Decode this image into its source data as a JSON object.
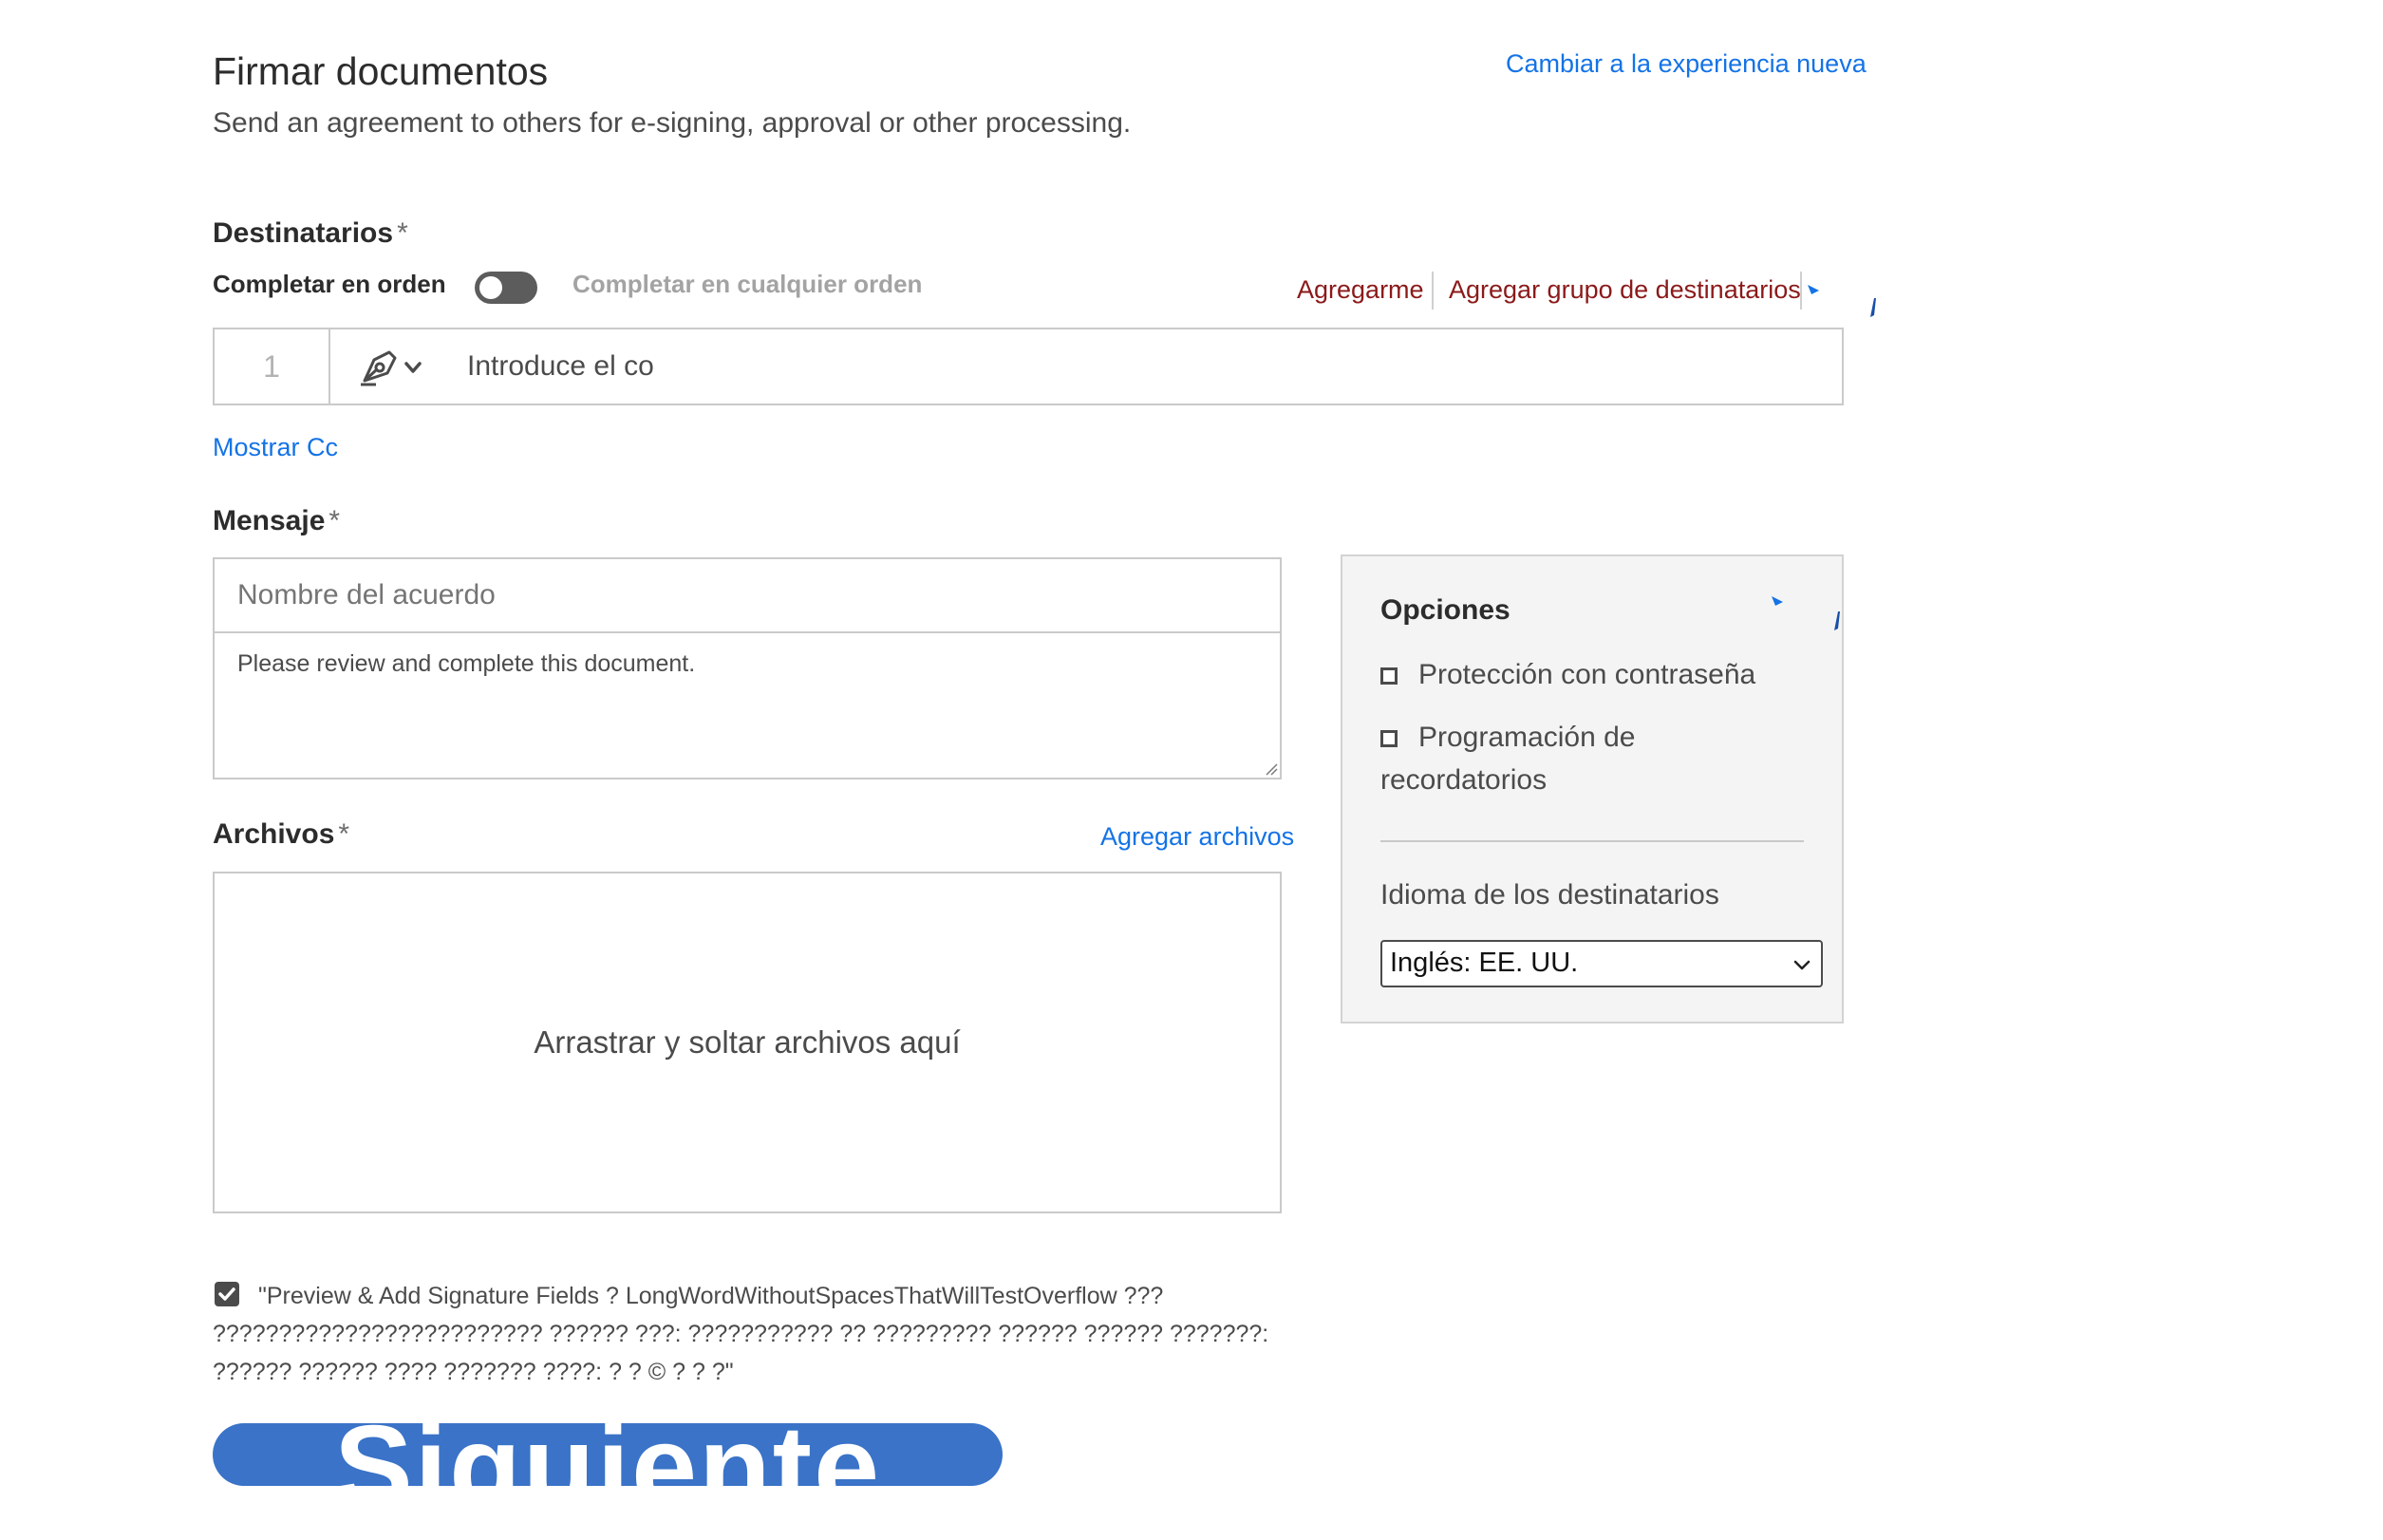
{
  "header": {
    "title": "Firmar documentos",
    "subtitle": "Send an agreement to others for e-signing, approval or other processing.",
    "switch_experience_link": "Cambiar a la experiencia nueva"
  },
  "recipients": {
    "label": "Destinatarios",
    "required_mark": "*",
    "complete_in_order_label": "Completar en orden",
    "complete_in_order_toggle": false,
    "complete_any_order_label": "Completar en cualquier orden",
    "add_me_link": "Agregarme",
    "add_group_link": "Agregar grupo de destinatarios",
    "rows": [
      {
        "number": "1",
        "role_icon": "pen-nib-icon",
        "input_value": "Introduce el co"
      }
    ],
    "show_cc_link": "Mostrar Cc"
  },
  "message": {
    "label": "Mensaje",
    "required_mark": "*",
    "agreement_name_placeholder": "Nombre del acuerdo",
    "body_value": "Please review and complete this document."
  },
  "files": {
    "label": "Archivos",
    "required_mark": "*",
    "add_files_link": "Agregar archivos",
    "drop_zone_text": "Arrastrar y soltar archivos aquí"
  },
  "options": {
    "title": "Opciones",
    "password_protection_label": "Protección con contraseña",
    "password_protection_checked": false,
    "reminder_label": "Programación de recordatorios",
    "reminder_checked": false,
    "recipient_language_label": "Idioma de los destinatarios",
    "recipient_language_value": "Inglés: EE. UU."
  },
  "preview": {
    "checked": true,
    "label": "\"Preview & Add Signature Fields ? LongWordWithoutSpacesThatWillTestOverflow ??? ????????????????????????? ?????? ???: ??????????? ?? ????????? ?????? ?????? ???????: ?????? ?????? ???? ??????? ????: ? ? © ? ? ?\""
  },
  "actions": {
    "next_label": "Siguiente"
  },
  "colors": {
    "link_blue": "#1473e6",
    "link_dark_red": "#8b1a1a",
    "primary_button": "#3a73c8",
    "options_panel_bg": "#f4f4f4"
  }
}
